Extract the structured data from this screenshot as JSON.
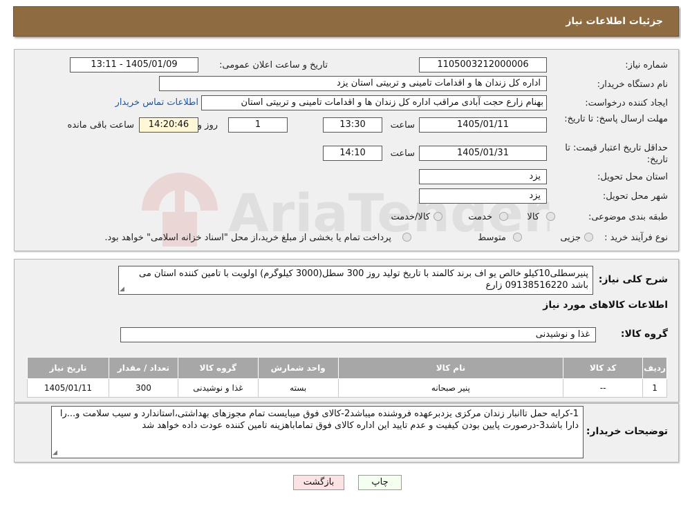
{
  "header": {
    "title": "جزئیات اطلاعات نیاز"
  },
  "form": {
    "need_number": {
      "label": "شماره نیاز:",
      "value": "1105003212000006"
    },
    "announce_datetime": {
      "label": "تاریخ و ساعت اعلان عمومی:",
      "value": "1405/01/09 - 13:11"
    },
    "buyer_org": {
      "label": "نام دستگاه خریدار:",
      "value": "اداره کل زندان ها و اقدامات تامینی و تربیتی استان یزد"
    },
    "requester": {
      "label": "ایجاد کننده درخواست:",
      "value": "بهنام زارع حجت آبادی مراقب اداره کل زندان ها و اقدامات تامینی و تربیتی استان",
      "contact_link": "اطلاعات تماس خریدار"
    },
    "deadline": {
      "label": "مهلت ارسال پاسخ: تا تاریخ:",
      "date": "1405/01/11",
      "time_label": "ساعت",
      "time": "13:30",
      "days": "1",
      "days_label": "روز و",
      "remaining": "14:20:46",
      "remaining_label": "ساعت باقی مانده"
    },
    "price_validity": {
      "label": "حداقل تاریخ اعتبار قیمت: تا تاریخ:",
      "date": "1405/01/31",
      "time_label": "ساعت",
      "time": "14:10"
    },
    "delivery_province": {
      "label": "استان محل تحویل:",
      "value": "یزد"
    },
    "delivery_city": {
      "label": "شهر محل تحویل:",
      "value": "یزد"
    },
    "category": {
      "label": "طبقه بندی موضوعی:",
      "options": [
        "کالا",
        "خدمت",
        "کالا/خدمت"
      ]
    },
    "purchase_type": {
      "label": "نوع فرآیند خرید :",
      "options": [
        "جزیی",
        "متوسط"
      ],
      "note": "پرداخت تمام یا بخشی از مبلغ خرید،از محل \"اسناد خزانه اسلامی\" خواهد بود."
    }
  },
  "summary": {
    "label": "شرح کلی نیاز:",
    "text": "پنیرسطلی10کیلو خالص یو اف برند کالمند با تاریخ تولید روز 300 سطل(3000 کیلوگرم) اولویت با تامین کننده استان می باشد 09138516220 زارع"
  },
  "goods": {
    "section_title": "اطلاعات کالاهای مورد نیاز",
    "group_label": "گروه کالا:",
    "group_value": "غذا و نوشیدنی",
    "table": {
      "headers": [
        "ردیف",
        "کد کالا",
        "نام کالا",
        "واحد شمارش",
        "گروه کالا",
        "تعداد / مقدار",
        "تاریخ نیاز"
      ],
      "rows": [
        [
          "1",
          "--",
          "پنیر صبحانه",
          "بسته",
          "غذا و نوشیدنی",
          "300",
          "1405/01/11"
        ]
      ]
    }
  },
  "buyer_notes": {
    "label": "توضیحات خریدار:",
    "text": "1-کرایه حمل تاانبار زندان مرکزی یزدبرعهده فروشنده میباشد2-کالای فوق میبایست تمام مجوزهای بهداشتی،استاندارد و سیب سلامت و...را دارا باشد3-درصورت پایین بودن کیفیت و عدم تایید این اداره کالای فوق تماماباهزینه تامین کننده عودت داده خواهد شد"
  },
  "buttons": {
    "print": "چاپ",
    "back": "بازگشت"
  },
  "watermark": {
    "text": "AriaTender.neT"
  }
}
